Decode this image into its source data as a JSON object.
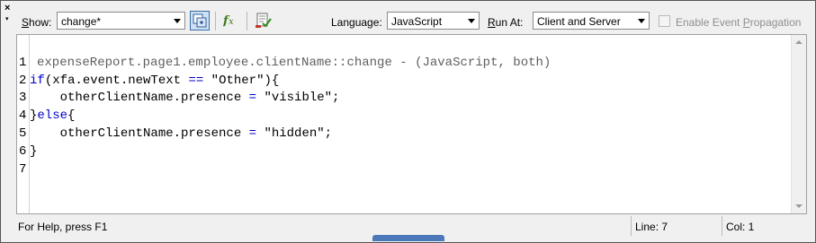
{
  "toolbar": {
    "close_glyph": "×",
    "menu_glyph": "▾",
    "show_label_accel": "S",
    "show_label_rest": "how:",
    "show_value": "change*",
    "language_label": "Language:",
    "language_value": "JavaScript",
    "run_at_label_accel": "R",
    "run_at_label_rest": "un At:",
    "run_at_value": "Client and Server",
    "enable_propagation_label_pre": "Enable Event ",
    "enable_propagation_label_accel": "P",
    "enable_propagation_label_post": "ropagation",
    "enable_propagation_checked": false
  },
  "editor": {
    "header": "expenseReport.page1.employee.clientName::change - (JavaScript, both)",
    "lines": [
      {
        "n": "1",
        "parts": []
      },
      {
        "n": "2",
        "parts": [
          [
            "kw",
            "if"
          ],
          [
            "t",
            "(xfa.event.newText "
          ],
          [
            "op",
            "=="
          ],
          [
            "t",
            " \"Other\"){"
          ]
        ]
      },
      {
        "n": "3",
        "parts": [
          [
            "t",
            "    otherClientName.presence "
          ],
          [
            "op",
            "="
          ],
          [
            "t",
            " \"visible\";"
          ]
        ]
      },
      {
        "n": "4",
        "parts": [
          [
            "t",
            "}"
          ],
          [
            "kw",
            "else"
          ],
          [
            "t",
            "{"
          ]
        ]
      },
      {
        "n": "5",
        "parts": [
          [
            "t",
            "    otherClientName.presence "
          ],
          [
            "op",
            "="
          ],
          [
            "t",
            " \"hidden\";"
          ]
        ]
      },
      {
        "n": "6",
        "parts": [
          [
            "t",
            "}"
          ]
        ]
      },
      {
        "n": "7",
        "parts": []
      }
    ]
  },
  "status": {
    "help_text": "For Help, press F1",
    "line": "Line: 7",
    "col": "Col: 1"
  },
  "icons": {
    "insert_events": "events-toggle-icon",
    "functions": "fx-functions-icon",
    "check_syntax": "check-script-syntax-icon"
  }
}
